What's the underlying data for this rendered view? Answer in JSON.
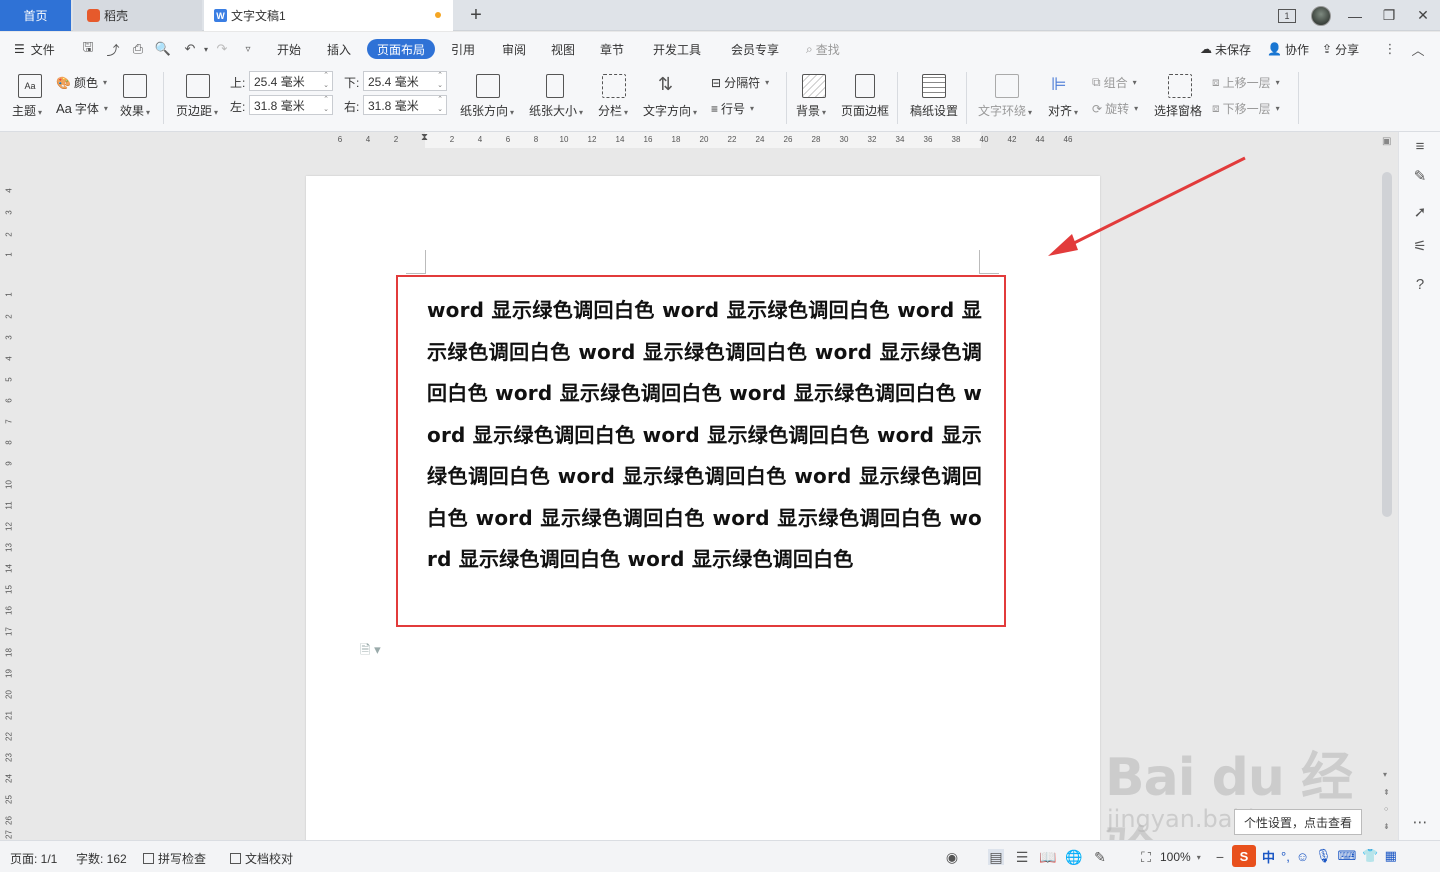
{
  "tabs": {
    "home": "首页",
    "daoke": "稻壳",
    "document": "文字文稿1",
    "add_icon": "+"
  },
  "window": {
    "page_indicator": "1"
  },
  "menu": {
    "file": "文件",
    "items": [
      "开始",
      "插入",
      "页面布局",
      "引用",
      "审阅",
      "视图",
      "章节",
      "开发工具",
      "会员专享"
    ],
    "active": "页面布局",
    "search": "查找",
    "unsaved": "未保存",
    "collab": "协作",
    "share": "分享"
  },
  "ribbon": {
    "theme": "主题",
    "color": "颜色",
    "font": "字体",
    "effect": "效果",
    "margins": "页边距",
    "top_label": "上:",
    "top_value": "25.4 毫米",
    "bottom_label": "下:",
    "bottom_value": "25.4 毫米",
    "left_label": "左:",
    "left_value": "31.8 毫米",
    "right_label": "右:",
    "right_value": "31.8 毫米",
    "orientation": "纸张方向",
    "size": "纸张大小",
    "columns": "分栏",
    "text_direction": "文字方向",
    "breaks": "分隔符",
    "line_numbers": "行号",
    "background": "背景",
    "page_border": "页面边框",
    "manuscript": "稿纸设置",
    "text_wrap": "文字环绕",
    "align": "对齐",
    "group": "组合",
    "rotate": "旋转",
    "selection_pane": "选择窗格",
    "bring_forward": "上移一层",
    "send_backward": "下移一层"
  },
  "ruler": {
    "h_ticks": [
      "6",
      "4",
      "2",
      "2",
      "4",
      "6",
      "8",
      "10",
      "12",
      "14",
      "16",
      "18",
      "20",
      "22",
      "24",
      "26",
      "28",
      "30",
      "32",
      "34",
      "36",
      "38",
      "40",
      "42",
      "44",
      "46"
    ],
    "v_ticks": [
      "4",
      "3",
      "2",
      "1",
      "1",
      "2",
      "3",
      "4",
      "5",
      "6",
      "7",
      "8",
      "9",
      "10",
      "11",
      "12",
      "13",
      "14",
      "15",
      "16",
      "17",
      "18",
      "19",
      "20",
      "21",
      "22",
      "23",
      "24",
      "25",
      "26",
      "27"
    ]
  },
  "document": {
    "body": "word 显示绿色调回白色 word 显示绿色调回白色 word 显示绿色调回白色 word 显示绿色调回白色 word 显示绿色调回白色 word 显示绿色调回白色 word 显示绿色调回白色 word 显示绿色调回白色 word 显示绿色调回白色 word 显示绿色调回白色 word 显示绿色调回白色 word 显示绿色调回白色 word 显示绿色调回白色 word 显示绿色调回白色 word 显示绿色调回白色 word 显示绿色调回白色"
  },
  "watermark": {
    "main": "Bai du 经验",
    "sub": "jingyan.baidu.com"
  },
  "tooltip": "个性设置，点击查看",
  "status": {
    "page": "页面: 1/1",
    "words": "字数: 162",
    "spell": "拼写检查",
    "proof": "文档校对",
    "zoom": "100%"
  },
  "ime": {
    "lang": "中"
  },
  "colors": {
    "accent": "#2f72d6",
    "highlight_border": "#e23b3b",
    "arrow": "#e23b3b"
  }
}
